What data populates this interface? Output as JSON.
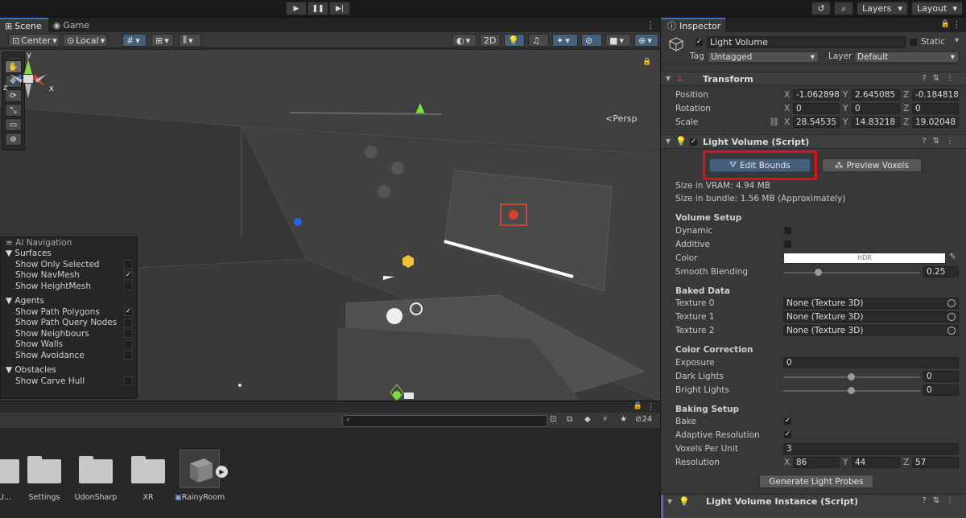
{
  "toolbar": {
    "play_icon": "play-icon",
    "pause_icon": "pause-icon",
    "step_icon": "step-icon",
    "history_icon": "history-icon",
    "search_icon": "search-icon",
    "layers_label": "Layers",
    "layout_label": "Layout"
  },
  "scene": {
    "tabs": [
      {
        "label": "Scene"
      },
      {
        "label": "Game"
      }
    ],
    "tools": {
      "pivot_label": "Center",
      "space_label": "Local",
      "twod_label": "2D"
    },
    "persp_label": "<Persp",
    "gizmo_axes": {
      "y": "y",
      "x": "x",
      "z": "z"
    }
  },
  "ai_navigation": {
    "title": "AI Navigation",
    "sections": [
      {
        "label": "Surfaces",
        "items": [
          {
            "label": "Show Only Selected",
            "checked": false
          },
          {
            "label": "Show NavMesh",
            "checked": true
          },
          {
            "label": "Show HeightMesh",
            "checked": false
          }
        ]
      },
      {
        "label": "Agents",
        "items": [
          {
            "label": "Show Path Polygons",
            "checked": true
          },
          {
            "label": "Show Path Query Nodes",
            "checked": false
          },
          {
            "label": "Show Neighbours",
            "checked": false
          },
          {
            "label": "Show Walls",
            "checked": false
          },
          {
            "label": "Show Avoidance",
            "checked": false
          }
        ]
      },
      {
        "label": "Obstacles",
        "items": [
          {
            "label": "Show Carve Hull",
            "checked": false
          }
        ]
      }
    ]
  },
  "project": {
    "hidden_count": "24",
    "assets": [
      {
        "label": "dU..."
      },
      {
        "label": "Settings"
      },
      {
        "label": "UdonSharp"
      },
      {
        "label": "XR"
      },
      {
        "label": "RainyRoom"
      }
    ]
  },
  "inspector": {
    "tab_label": "Inspector",
    "object_name": "Light Volume",
    "static_label": "Static",
    "tag_label": "Tag",
    "tag_value": "Untagged",
    "layer_label": "Layer",
    "layer_value": "Default",
    "transform": {
      "title": "Transform",
      "position_label": "Position",
      "rotation_label": "Rotation",
      "scale_label": "Scale",
      "position": {
        "x": "-1.062898",
        "y": "2.645085",
        "z": "-0.1848183"
      },
      "rotation": {
        "x": "0",
        "y": "0",
        "z": "0"
      },
      "scale": {
        "x": "28.54535",
        "y": "14.83218",
        "z": "19.02048"
      }
    },
    "light_volume": {
      "title": "Light Volume (Script)",
      "edit_bounds_label": "Edit Bounds",
      "preview_voxels_label": "Preview Voxels",
      "vram_text": "Size in VRAM: 4.94 MB",
      "bundle_text": "Size in bundle: 1.56 MB (Approximately)",
      "volume_setup": {
        "title": "Volume Setup",
        "dynamic_label": "Dynamic",
        "additive_label": "Additive",
        "color_label": "Color",
        "color_value_label": "HDR",
        "smooth_blending_label": "Smooth Blending",
        "smooth_blending_value": "0.25",
        "smooth_blending_level": 0.25
      },
      "baked_data": {
        "title": "Baked Data",
        "textures": [
          {
            "label": "Texture 0",
            "value": "None (Texture 3D)"
          },
          {
            "label": "Texture 1",
            "value": "None (Texture 3D)"
          },
          {
            "label": "Texture 2",
            "value": "None (Texture 3D)"
          }
        ]
      },
      "color_correction": {
        "title": "Color Correction",
        "exposure_label": "Exposure",
        "exposure_value": "0",
        "dark_lights_label": "Dark Lights",
        "dark_lights_value": "0",
        "bright_lights_label": "Bright Lights",
        "bright_lights_value": "0"
      },
      "baking_setup": {
        "title": "Baking Setup",
        "bake_label": "Bake",
        "bake_checked": true,
        "adaptive_label": "Adaptive Resolution",
        "adaptive_checked": true,
        "voxels_label": "Voxels Per Unit",
        "voxels_value": "3",
        "resolution_label": "Resolution",
        "resolution": {
          "x": "86",
          "y": "44",
          "z": "57"
        }
      },
      "generate_label": "Generate Light Probes"
    },
    "instance": {
      "title": "Light Volume Instance (Script)"
    }
  },
  "axis_labels": {
    "x": "X",
    "y": "Y",
    "z": "Z"
  },
  "colors": {
    "highlight": "#e00f1c",
    "accent": "#3a79bb",
    "pressed_button": "#46607c"
  }
}
